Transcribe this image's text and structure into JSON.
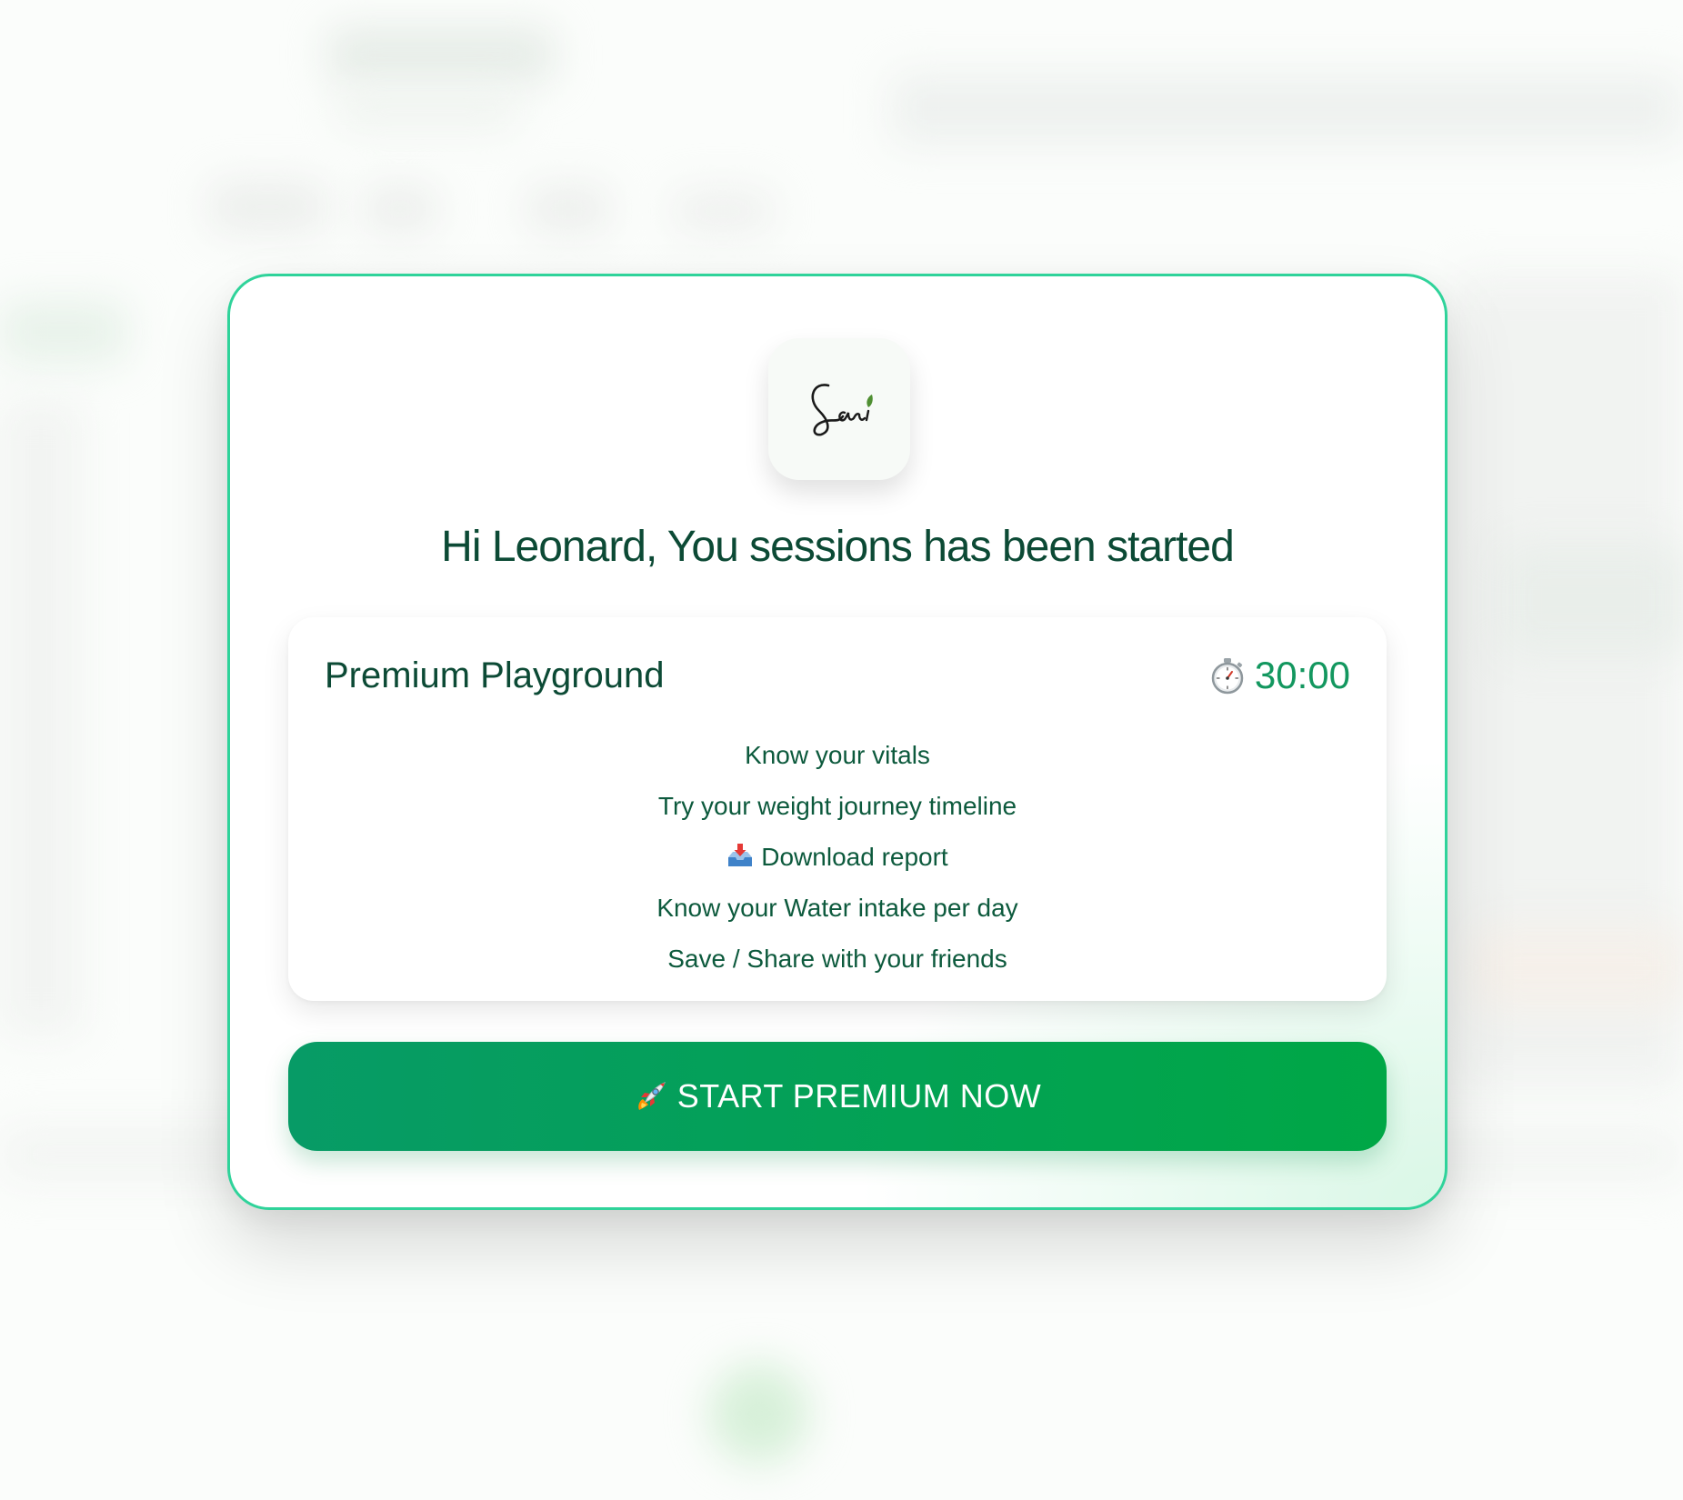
{
  "modal": {
    "logo": {
      "icon": "sari-signature-logo",
      "text": "Sari"
    },
    "headline": "Hi Leonard, You sessions has been started",
    "plan": {
      "title": "Premium Playground",
      "timer_icon": "stopwatch-icon",
      "timer": "30:00",
      "features": [
        {
          "label": "Know your vitals"
        },
        {
          "label": "Try your weight journey timeline"
        },
        {
          "icon": "inbox-tray-icon",
          "label": "Download report"
        },
        {
          "label": "Know your Water intake per day"
        },
        {
          "label": "Save / Share with your friends"
        }
      ]
    },
    "cta": {
      "icon": "rocket-icon",
      "label": "START PREMIUM NOW"
    }
  },
  "colors": {
    "accent": "#2fd39a",
    "text_dark_green": "#0c4a35",
    "timer_green": "#13975f",
    "button_start": "#079b66",
    "button_end": "#00a746"
  }
}
